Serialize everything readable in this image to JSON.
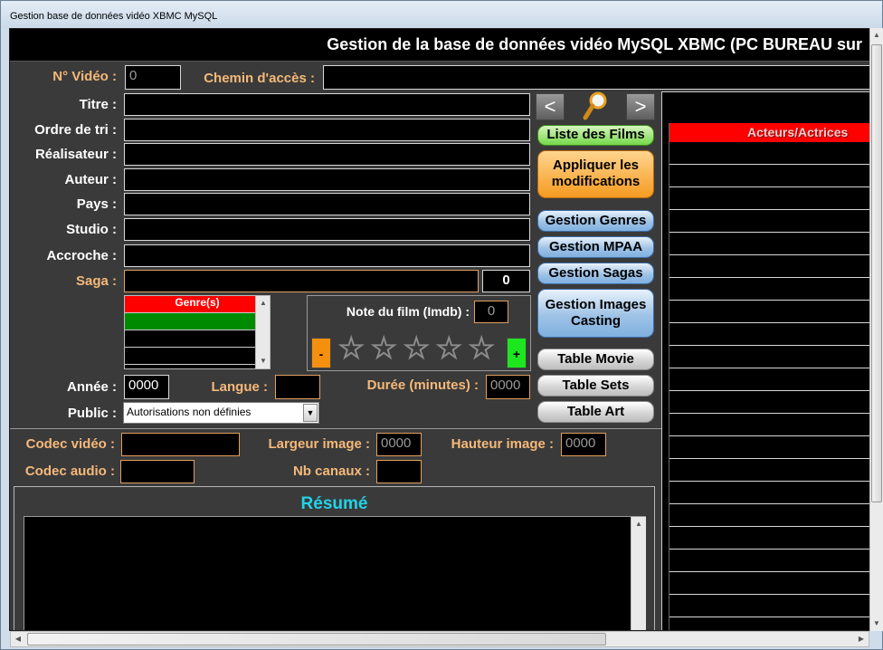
{
  "window": {
    "title": "Gestion base de données vidéo XBMC MySQL"
  },
  "header": {
    "title": "Gestion de la base de données vidéo MySQL XBMC (PC BUREAU sur"
  },
  "labels": {
    "no_video": "N° Vidéo :",
    "chemin": "Chemin d'accès :",
    "titre": "Titre :",
    "ordre_tri": "Ordre de tri :",
    "realisateur": "Réalisateur :",
    "auteur": "Auteur :",
    "pays": "Pays :",
    "studio": "Studio :",
    "accroche": "Accroche :",
    "saga": "Saga :",
    "annee": "Année :",
    "langue": "Langue :",
    "duree": "Durée (minutes) :",
    "public": "Public :",
    "codec_video": "Codec vidéo :",
    "codec_audio": "Codec audio :",
    "largeur": "Largeur image :",
    "hauteur": "Hauteur image :",
    "nb_canaux": "Nb canaux :",
    "note": "Note du film (Imdb) :"
  },
  "values": {
    "no_video": "0",
    "saga_count": "0",
    "note": "0",
    "annee": "0000",
    "duree": "0000",
    "largeur": "0000",
    "hauteur": "0000"
  },
  "genres": {
    "header": "Genre(s)"
  },
  "public_select": {
    "selected": "Autorisations non définies"
  },
  "buttons": {
    "liste_films": "Liste des Films",
    "appliquer": "Appliquer les modifications",
    "gestion_genres": "Gestion Genres",
    "gestion_mpaa": "Gestion MPAA",
    "gestion_sagas": "Gestion Sagas",
    "gestion_images": "Gestion Images Casting",
    "table_movie": "Table Movie",
    "table_sets": "Table Sets",
    "table_art": "Table Art",
    "minus": "-",
    "plus": "+",
    "prev": "<",
    "next": ">"
  },
  "resume": {
    "title": "Résumé"
  },
  "actors": {
    "header": "Acteurs/Actrices"
  },
  "rating": {
    "stars": [
      "☆",
      "☆",
      "☆",
      "☆",
      "☆"
    ]
  },
  "colors": {
    "accent_orange": "#f5b97a",
    "resume_title": "#22d3e8",
    "actors_header": "#ff0000"
  }
}
